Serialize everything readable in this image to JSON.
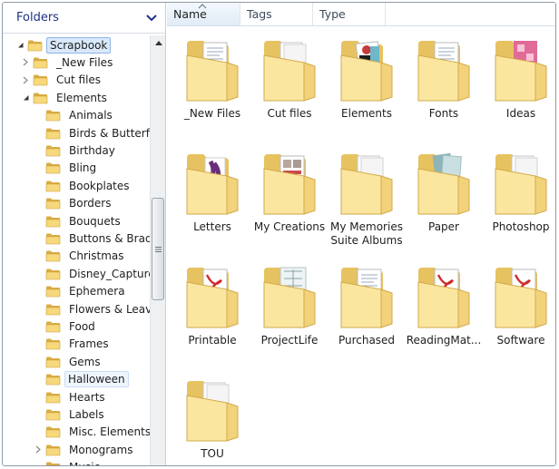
{
  "left_pane": {
    "title": "Folders",
    "tree": [
      {
        "label": "Scrapbook",
        "level": 0,
        "expander": "down",
        "state": "selected"
      },
      {
        "label": "_New Files",
        "level": 1,
        "expander": "right"
      },
      {
        "label": "Cut files",
        "level": 1,
        "expander": "right"
      },
      {
        "label": "Elements",
        "level": 1,
        "expander": "down"
      },
      {
        "label": "Animals",
        "level": 2
      },
      {
        "label": "Birds & Butterflies",
        "level": 2
      },
      {
        "label": "Birthday",
        "level": 2
      },
      {
        "label": "Bling",
        "level": 2
      },
      {
        "label": "Bookplates",
        "level": 2
      },
      {
        "label": "Borders",
        "level": 2
      },
      {
        "label": "Bouquets",
        "level": 2
      },
      {
        "label": "Buttons & Brads",
        "level": 2
      },
      {
        "label": "Christmas",
        "level": 2
      },
      {
        "label": "Disney_Captures",
        "level": 2
      },
      {
        "label": "Ephemera",
        "level": 2
      },
      {
        "label": "Flowers & Leaves",
        "level": 2
      },
      {
        "label": "Food",
        "level": 2
      },
      {
        "label": "Frames",
        "level": 2
      },
      {
        "label": "Gems",
        "level": 2
      },
      {
        "label": "Halloween",
        "level": 2,
        "state": "hover"
      },
      {
        "label": "Hearts",
        "level": 2
      },
      {
        "label": "Labels",
        "level": 2
      },
      {
        "label": "Misc. Elements",
        "level": 2
      },
      {
        "label": "Monograms",
        "level": 2,
        "expander": "right"
      },
      {
        "label": "Music",
        "level": 2
      }
    ]
  },
  "columns": [
    {
      "label": "Name",
      "sorted": true
    },
    {
      "label": "Tags"
    },
    {
      "label": "Type"
    }
  ],
  "items": [
    {
      "label": "_New Files",
      "preview": "doc"
    },
    {
      "label": "Cut files",
      "preview": "plain"
    },
    {
      "label": "Elements",
      "preview": "art"
    },
    {
      "label": "Fonts",
      "preview": "doc"
    },
    {
      "label": "Ideas",
      "preview": "pink"
    },
    {
      "label": "Letters",
      "preview": "purple"
    },
    {
      "label": "My Creations",
      "preview": "layout"
    },
    {
      "label": "My Memories Suite Albums",
      "preview": "plain"
    },
    {
      "label": "Paper",
      "preview": "paper"
    },
    {
      "label": "Photoshop",
      "preview": "plain"
    },
    {
      "label": "Printable",
      "preview": "pdf"
    },
    {
      "label": "ProjectLife",
      "preview": "grid"
    },
    {
      "label": "Purchased",
      "preview": "doc"
    },
    {
      "label": "ReadingMat...",
      "preview": "pdf"
    },
    {
      "label": "Software",
      "preview": "pdf"
    },
    {
      "label": "TOU",
      "preview": "plain"
    }
  ],
  "colors": {
    "folder_back": "#e7c260",
    "folder_front": "#fbe6a0",
    "selection": "#d9e9fb",
    "header_text": "#1e3287"
  }
}
